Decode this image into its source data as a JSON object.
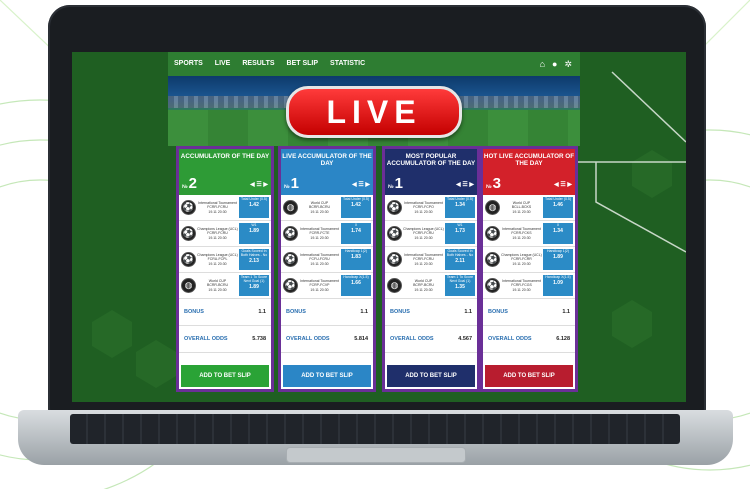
{
  "nav": {
    "items": [
      "SPORTS",
      "LIVE",
      "RESULTS",
      "BET SLIP",
      "STATISTIC"
    ],
    "icons": [
      "home-icon",
      "user-icon",
      "gear-icon"
    ]
  },
  "hero": {
    "title": "LIVE"
  },
  "cards": [
    {
      "title": "ACCUMULATOR OF THE DAY",
      "prefix": "№",
      "number": "2",
      "head_color": "#2e9b36",
      "matches": [
        {
          "league": "International Tournament",
          "teams": "FCRR-FCRU",
          "date": "19.11 20:30",
          "market": "Total Under (0.5)",
          "odd": "1.42"
        },
        {
          "league": "Champions League (UCL)",
          "teams": "FCRR-FCRU",
          "date": "19.11 20:30",
          "market": "W1",
          "odd": "1.89"
        },
        {
          "league": "Champions League (UCL)",
          "teams": "FCRU-FCPL",
          "date": "19.11 20:30",
          "market": "Goals Scored In Both Halves - No",
          "odd": "2.13"
        },
        {
          "league": "World CUP",
          "teams": "BCRR-BCRU",
          "date": "19.11 20:30",
          "market": "Team 1 To Score Next Goal (1)",
          "odd": "1.89"
        }
      ],
      "bonus_label": "BONUS",
      "bonus": "1.1",
      "odds_label": "OVERALL ODDS",
      "odds": "5.738",
      "button": "ADD TO BET SLIP",
      "btn_color": "#2aa336"
    },
    {
      "title": "LIVE ACCUMULATOR OF THE DAY",
      "prefix": "№",
      "number": "1",
      "head_color": "#2b86c6",
      "matches": [
        {
          "league": "World CUP",
          "teams": "BCRR-BCRU",
          "date": "19.11 20:30",
          "market": "Total Under (0.5)",
          "odd": "1.42"
        },
        {
          "league": "International Tournament",
          "teams": "FCRR-FCTE",
          "date": "19.11 20:30",
          "market": "X",
          "odd": "1.74"
        },
        {
          "league": "International Tournament",
          "teams": "FCFU-FCRU",
          "date": "19.11 20:30",
          "market": "Handicap 1(2)",
          "odd": "1.83"
        },
        {
          "league": "International Tournament",
          "teams": "FCRP-FCVP",
          "date": "19.11 20:30",
          "market": "Handicap X(1.5)",
          "odd": "1.66"
        }
      ],
      "bonus_label": "BONUS",
      "bonus": "1.1",
      "odds_label": "OVERALL ODDS",
      "odds": "5.814",
      "button": "ADD TO BET SLIP",
      "btn_color": "#2b86c6"
    },
    {
      "title": "MOST POPULAR ACCUMULATOR OF THE DAY",
      "prefix": "№",
      "number": "1",
      "head_color": "#1f2f6b",
      "matches": [
        {
          "league": "International Tournament",
          "teams": "FCRR-FCPO",
          "date": "19.11 20:30",
          "market": "Total Under (0.5)",
          "odd": "1.34"
        },
        {
          "league": "Champions League (UCL)",
          "teams": "FCRR-FCRU",
          "date": "19.11 20:30",
          "market": "W1",
          "odd": "1.73"
        },
        {
          "league": "International Tournament",
          "teams": "FCRR-FCRU",
          "date": "19.11 20:30",
          "market": "Goals Scored In Both Halves - No",
          "odd": "2.11"
        },
        {
          "league": "World CUP",
          "teams": "BCRP-BCRU",
          "date": "19.11 20:30",
          "market": "Team 1 To Score Next Goal (1)",
          "odd": "1.35"
        }
      ],
      "bonus_label": "BONUS",
      "bonus": "1.1",
      "odds_label": "OVERALL ODDS",
      "odds": "4.567",
      "button": "ADD TO BET SLIP",
      "btn_color": "#1f2f6b"
    },
    {
      "title": "HOT LIVE ACCUMULATOR OF THE DAY",
      "prefix": "№",
      "number": "3",
      "head_color": "#d3212a",
      "matches": [
        {
          "league": "World CUP",
          "teams": "BCLL-BCKS",
          "date": "19.11 20:30",
          "market": "Total Under (0.5)",
          "odd": "1.46"
        },
        {
          "league": "International Tournament",
          "teams": "FCRR-FCKS",
          "date": "19.11 20:30",
          "market": "X",
          "odd": "1.34"
        },
        {
          "league": "Champions League (UCL)",
          "teams": "FCRR-FCRR",
          "date": "19.11 20:30",
          "market": "Handicap 1(2)",
          "odd": "1.89"
        },
        {
          "league": "International Tournament",
          "teams": "FCRR-FCGS",
          "date": "19.11 20:30",
          "market": "Handicap X(1.5)",
          "odd": "1.09"
        }
      ],
      "bonus_label": "BONUS",
      "bonus": "1.1",
      "odds_label": "OVERALL ODDS",
      "odds": "6.128",
      "button": "ADD TO BET SLIP",
      "btn_color": "#b81d2f"
    }
  ],
  "colors": {
    "border": "#6a2f97",
    "nav": "#2e7d32",
    "odd_bg": "#2b8bc6"
  }
}
